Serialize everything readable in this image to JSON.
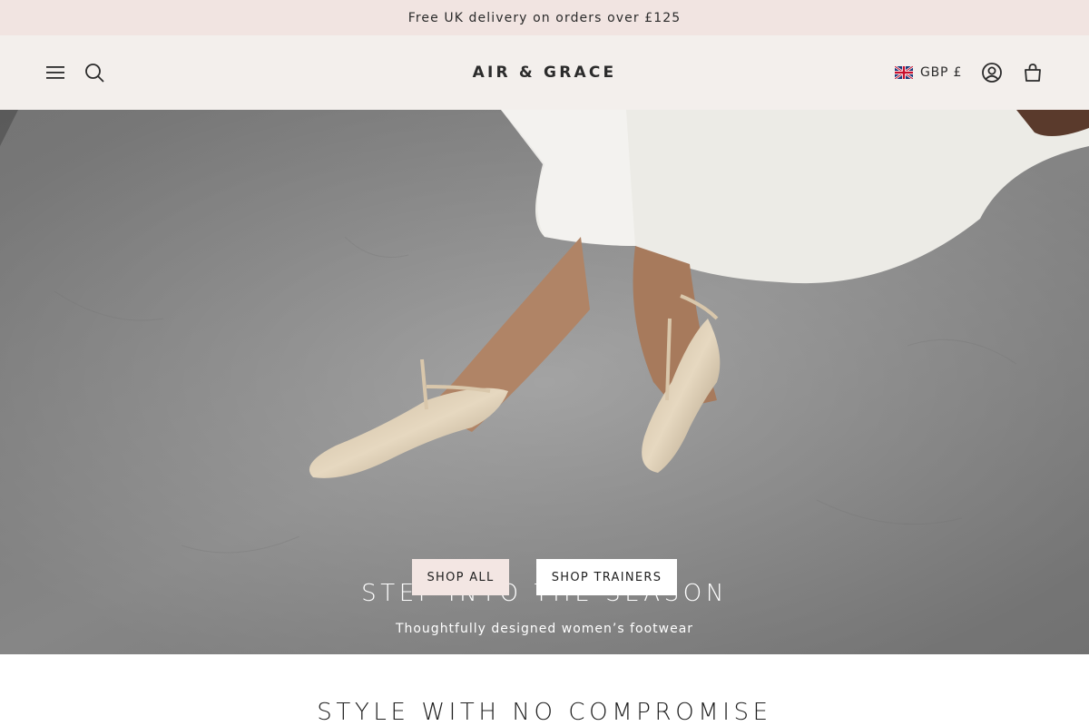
{
  "announcement": {
    "text": "Free UK delivery on orders over £125"
  },
  "header": {
    "logo_text": "AIR & GRACE",
    "currency_label": "GBP £",
    "icons": [
      "hamburger-menu-icon",
      "search-icon",
      "uk-flag-icon",
      "account-icon",
      "shopping-bag-icon"
    ]
  },
  "hero": {
    "title": "STEP INTO THE SEASON",
    "subtitle": "Thoughtfully designed women’s footwear",
    "buttons": {
      "shop_all": "SHOP ALL",
      "shop_trainers": "SHOP TRAINERS"
    }
  },
  "section": {
    "title": "STYLE WITH NO COMPROMISE"
  },
  "colors": {
    "announce_bg": "#f1e4e1",
    "header_bg": "#f3efec",
    "cta_primary_bg": "#f3e6e3",
    "cta_secondary_bg": "#ffffff",
    "text_dark": "#1f1f1f"
  }
}
